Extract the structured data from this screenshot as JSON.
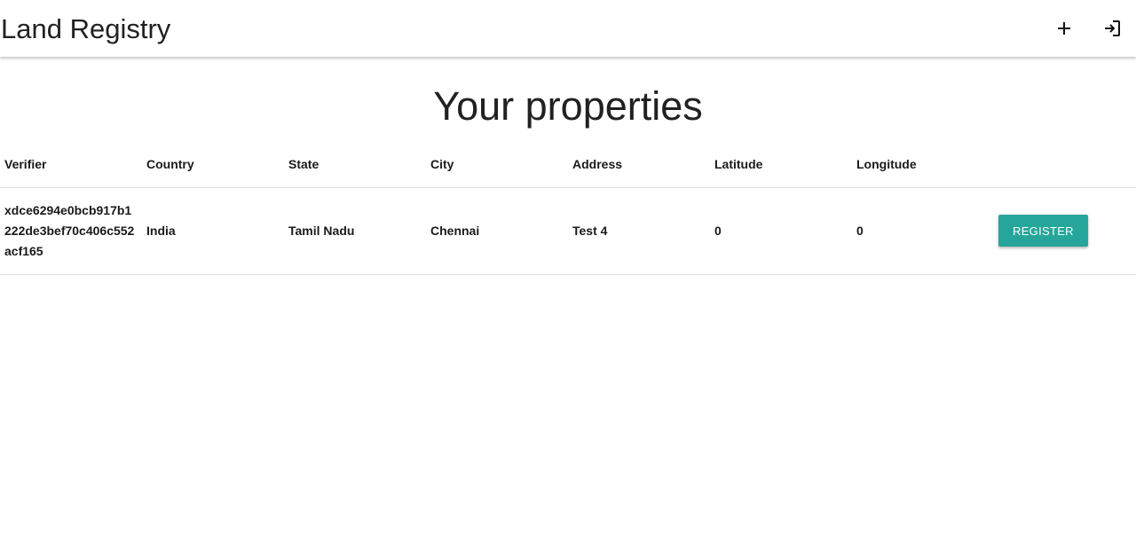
{
  "app": {
    "title": "Land Registry",
    "icons": {
      "add": "plus-icon",
      "logout": "logout-icon"
    }
  },
  "page": {
    "heading": "Your properties"
  },
  "table": {
    "headers": {
      "verifier": "Verifier",
      "country": "Country",
      "state": "State",
      "city": "City",
      "address": "Address",
      "latitude": "Latitude",
      "longitude": "Longitude",
      "action": ""
    },
    "rows": [
      {
        "verifier": "xdce6294e0bcb917b1222de3bef70c406c552acf165",
        "country": "India",
        "state": "Tamil Nadu",
        "city": "Chennai",
        "address": "Test 4",
        "latitude": "0",
        "longitude": "0",
        "action_label": "REGISTER"
      }
    ]
  },
  "colors": {
    "accent": "#26a69a",
    "text": "#212121",
    "divider": "#e0e0e0"
  }
}
